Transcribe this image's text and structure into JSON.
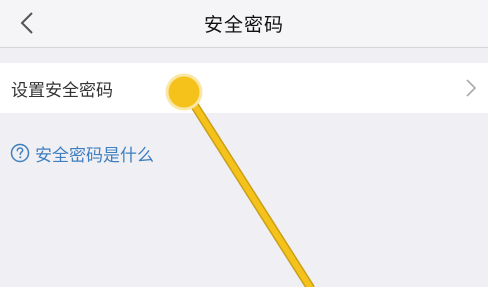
{
  "header": {
    "title": "安全密码",
    "back_icon": "chevron-left-icon"
  },
  "settings": {
    "row_label": "设置安全密码",
    "row_icon": "chevron-right-icon"
  },
  "help": {
    "link_text": "安全密码是什么",
    "icon": "question-circle-icon"
  },
  "annotation": {
    "marker_color": "#f5c21b",
    "line_color": "#f5c21b"
  },
  "colors": {
    "background": "#efeff4",
    "link": "#3f7fbf"
  }
}
